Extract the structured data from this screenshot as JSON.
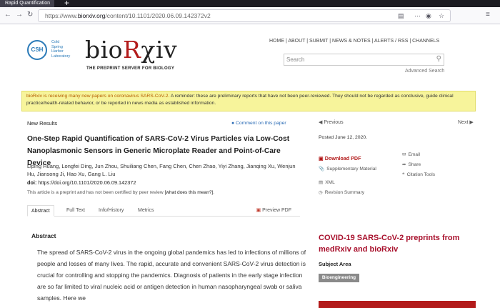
{
  "browser": {
    "tab_title": "Rapid Quantification",
    "new_tab": "+",
    "url_prefix": "https://www.",
    "url_host": "biorxiv.org",
    "url_path": "/content/10.1101/2020.06.09.142372v2"
  },
  "header": {
    "csh_initials": "CSH",
    "csh_lines": [
      "Cold",
      "Spring",
      "Harbor",
      "Laboratory"
    ],
    "brand_prefix": "bio",
    "brand_r": "R",
    "brand_suffix": "χiv",
    "tagline": "THE PREPRINT SERVER FOR BIOLOGY",
    "nav": "HOME | ABOUT | SUBMIT | NEWS & NOTES | ALERTS / RSS | CHANNELS",
    "search_placeholder": "Search",
    "advanced_search": "Advanced Search"
  },
  "banner": {
    "prefix": "bioRxiv is receiving many new papers on coronavirus SARS-CoV-2.",
    "warning": "A reminder: these are preliminary reports that have not been peer-reviewed. They should not be regarded as conclusive, guide clinical practice/health-related behavior, or be reported in news media as established information."
  },
  "article": {
    "section": "New Results",
    "comment": "Comment on this paper",
    "title": "One-Step Rapid Quantification of SARS-CoV-2 Virus Particles via Low-Cost Nanoplasmonic Sensors in Generic Microplate Reader and Point-of-Care Device",
    "authors": "Liping Huang, Longfei Ding, Jun Zhou, Shuiliang Chen, Fang Chen, Chen Zhao, Yiyi Zhang, Jianqing Xu, Wenjun Hu, Jiansong Ji, Hao Xu, Gang L. Liu",
    "doi_label": "doi:",
    "doi_value": "https://doi.org/10.1101/2020.06.09.142372",
    "preprint_note": "This article is a preprint and has not been certified by peer review",
    "what_link": "[what does this mean?]",
    "tabs": [
      "Abstract",
      "Full Text",
      "Info/History",
      "Metrics"
    ],
    "preview_pdf": "Preview PDF",
    "abstract_heading": "Abstract",
    "abstract_text": "The spread of SARS-CoV-2 virus in the ongoing global pandemics has led to infections of millions of people and losses of many lives. The rapid, accurate and convenient SARS-CoV-2 virus detection is crucial for controlling and stopping the pandemics. Diagnosis of patients in the early stage infection are so far limited to viral nucleic acid or antigen detection in human nasopharyngeal swab or saliva samples. Here we"
  },
  "sidebar": {
    "previous": "Previous",
    "next": "Next",
    "posted": "Posted June 12, 2020.",
    "download_pdf": "Download PDF",
    "supplementary": "Supplementary Material",
    "xml": "XML",
    "revision": "Revision Summary",
    "email": "Email",
    "share": "Share",
    "citation": "Citation Tools",
    "covid_title": "COVID-19 SARS-CoV-2 preprints from medRxiv and bioRxiv",
    "subject_area": "Subject Area",
    "subject_badge": "Bioengineering"
  }
}
